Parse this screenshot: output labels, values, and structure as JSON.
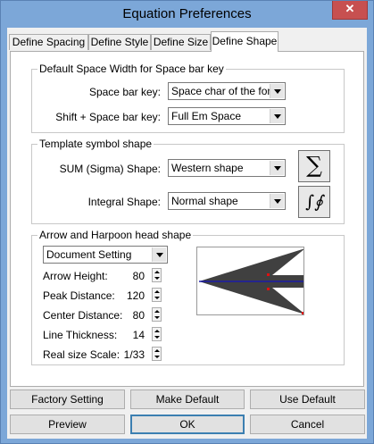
{
  "window": {
    "title": "Equation Preferences",
    "close_glyph": "✕"
  },
  "tabs": [
    {
      "label": "Define Spacing"
    },
    {
      "label": "Define Style"
    },
    {
      "label": "Define Size"
    },
    {
      "label": "Define Shape",
      "active": true
    }
  ],
  "space_group": {
    "legend": "Default Space Width for Space bar key",
    "space_bar": {
      "label": "Space bar key:",
      "value": "Space char of the font"
    },
    "shift_space": {
      "label": "Shift + Space bar key:",
      "value": "Full Em Space"
    }
  },
  "template_group": {
    "legend": "Template symbol shape",
    "sum": {
      "label": "SUM (Sigma) Shape:",
      "value": "Western shape",
      "preview_glyph": "∑"
    },
    "integral": {
      "label": "Integral Shape:",
      "value": "Normal shape",
      "preview_glyph": "∫∮"
    }
  },
  "arrow_group": {
    "legend": "Arrow and Harpoon head shape",
    "mode": "Document Setting",
    "fields": [
      {
        "label": "Arrow Height:",
        "value": "80"
      },
      {
        "label": "Peak Distance:",
        "value": "120"
      },
      {
        "label": "Center Distance:",
        "value": "80"
      },
      {
        "label": "Line Thickness:",
        "value": "14"
      },
      {
        "label": "Real size Scale:",
        "value": "1/33"
      }
    ]
  },
  "buttons": {
    "factory": "Factory Setting",
    "make_default": "Make Default",
    "use_default": "Use Default",
    "preview": "Preview",
    "ok": "OK",
    "cancel": "Cancel"
  },
  "colors": {
    "titlebar": "#7ca7d8",
    "close": "#c75050",
    "arrow_fill": "#404040",
    "center_line": "#1a1aa8",
    "handle": "#e01010"
  }
}
